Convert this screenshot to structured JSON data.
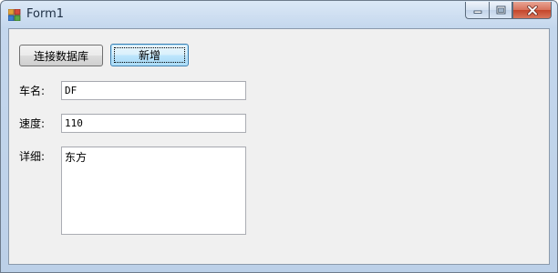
{
  "window": {
    "title": "Form1",
    "controls": {
      "minimize": "minimize-icon",
      "maximize": "maximize-icon",
      "close": "close-icon"
    }
  },
  "form": {
    "connect_button": "连接数据库",
    "add_button": "新增",
    "name_label": "车名:",
    "name_value": "DF",
    "speed_label": "速度:",
    "speed_value": "110",
    "detail_label": "详细:",
    "detail_value": "东方"
  }
}
